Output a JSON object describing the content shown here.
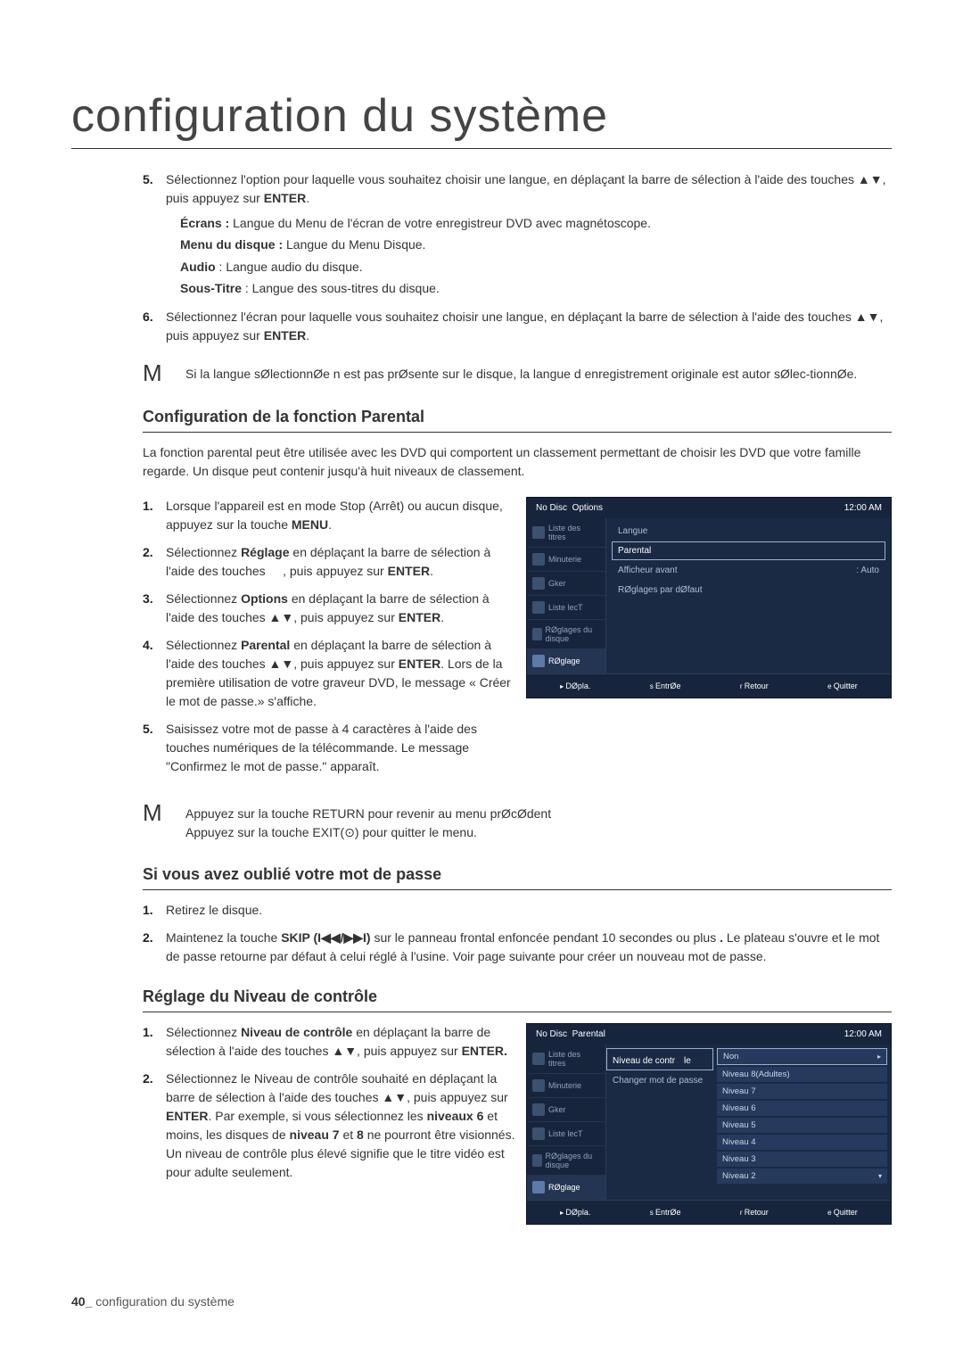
{
  "title": "configuration du système",
  "top_steps": [
    {
      "text": "Sélectionnez l'option pour laquelle vous souhaitez choisir une langue, en déplaçant la barre de sélection à l'aide des touches ▲▼, puis appuyez sur ",
      "tail_bold": "ENTER",
      "tail_after": ".",
      "defs": [
        {
          "label": "Écrans :",
          "body": " Langue du Menu de l'écran de votre enregistreur DVD avec magnétoscope."
        },
        {
          "label": "Menu du disque :",
          "body": " Langue du Menu Disque."
        },
        {
          "label": "Audio",
          "body": " : Langue audio du disque."
        },
        {
          "label": "Sous-Titre",
          "body": " : Langue des sous-titres du disque."
        }
      ]
    },
    {
      "text": "Sélectionnez l'écran pour laquelle vous souhaitez choisir une langue, en déplaçant la barre de sélection à l'aide des touches ▲▼, puis appuyez sur ",
      "tail_bold": "ENTER",
      "tail_after": "."
    }
  ],
  "top_steps_start": 5,
  "note_letter": "M",
  "note_text": "Si la langue sØlectionnØe n est pas prØsente sur le disque, la langue d enregistrement originale est autor sØlec-tionnØe.",
  "parental": {
    "heading": "Configuration de la fonction Parental",
    "intro": "La fonction parental peut être utilisée avec les DVD qui comportent un classement permettant de choisir les DVD que votre famille regarde. Un disque peut contenir jusqu'à huit niveaux de classement.",
    "steps": [
      "Lorsque l'appareil est en mode Stop (Arrêt) ou aucun disque, appuyez sur la touche <b>MENU</b>.",
      "Sélectionnez <b>Réglage</b> en déplaçant la barre de sélection à l'aide des touches     , puis appuyez sur <b>ENTER</b>.",
      "Sélectionnez <b>Options</b> en déplaçant la barre de sélection à l'aide des touches ▲▼, puis appuyez sur <b>ENTER</b>.",
      "Sélectionnez <b>Parental</b> en déplaçant la barre de sélection à l'aide des touches ▲▼, puis appuyez sur <b>ENTER</b>. Lors de la première utilisation de votre graveur DVD, le message « Créer le mot de passe.» s'affiche.",
      "Saisissez votre mot de passe à 4 caractères à l'aide des touches numériques de la télécommande. Le message \"Confirmez le mot de passe.\" apparaît."
    ],
    "note_a": "Appuyez sur la touche RETURN pour revenir au menu prØcØdent",
    "note_b": "Appuyez sur la touche EXIT(⊙) pour quitter le menu."
  },
  "forgot": {
    "heading": "Si vous avez oublié votre mot de passe",
    "steps": [
      "Retirez le disque.",
      "Maintenez la touche <b>SKIP (I◀◀/▶▶I)</b> sur le panneau frontal enfoncée pendant 10 secondes ou plus <b>.</b> Le plateau s'ouvre et le mot de passe retourne par défaut à celui réglé à l'usine. Voir page suivante pour créer un nouveau mot de passe."
    ]
  },
  "level": {
    "heading": "Réglage du Niveau de contrôle",
    "steps": [
      "Sélectionnez <b>Niveau de contrôle</b> en déplaçant la barre de sélection à l'aide des touches ▲▼, puis appuyez sur <b>ENTER.</b>",
      "Sélectionnez le Niveau de contrôle souhaité en déplaçant la barre de sélection à l'aide des touches ▲▼, puis appuyez sur <b>ENTER</b>. Par exemple, si vous sélectionnez les <b>niveaux 6</b> et moins, les disques de <b>niveau 7</b> et <b>8</b> ne pourront être visionnés. Un niveau de contrôle plus élevé signifie que le titre vidéo est pour adulte seulement."
    ]
  },
  "screen1": {
    "header_left": "No Disc",
    "crumb": "Options",
    "time": "12:00 AM",
    "sidebar": [
      "Liste des titres",
      "Minuterie",
      "Gker",
      "Liste lecT",
      "RØglages du disque",
      "RØglage"
    ],
    "opts": [
      {
        "label": "Langue",
        "val": ""
      },
      {
        "label": "Parental",
        "val": "",
        "sel": true
      },
      {
        "label": "Afficheur avant",
        "val": ": Auto"
      },
      {
        "label": "RØglages par dØfaut",
        "val": ""
      }
    ],
    "footer": [
      "DØpla.",
      "EntrØe",
      "Retour",
      "Quitter"
    ]
  },
  "screen2": {
    "header_left": "No Disc",
    "crumb": "Parental",
    "time": "12:00 AM",
    "sidebar": [
      "Liste des titres",
      "Minuterie",
      "Gker",
      "Liste lecT",
      "RØglages du disque",
      "RØglage"
    ],
    "subopts": [
      {
        "label": "Niveau de contr　le",
        "sel": true
      },
      {
        "label": "Changer mot de passe"
      }
    ],
    "levels": [
      "Non",
      "Niveau 8(Adultes)",
      "Niveau 7",
      "Niveau 6",
      "Niveau 5",
      "Niveau 4",
      "Niveau 3",
      "Niveau 2"
    ],
    "footer": [
      "DØpla.",
      "EntrØe",
      "Retour",
      "Quitter"
    ]
  },
  "page_footer": {
    "num": "40_",
    "label": " configuration du système"
  }
}
